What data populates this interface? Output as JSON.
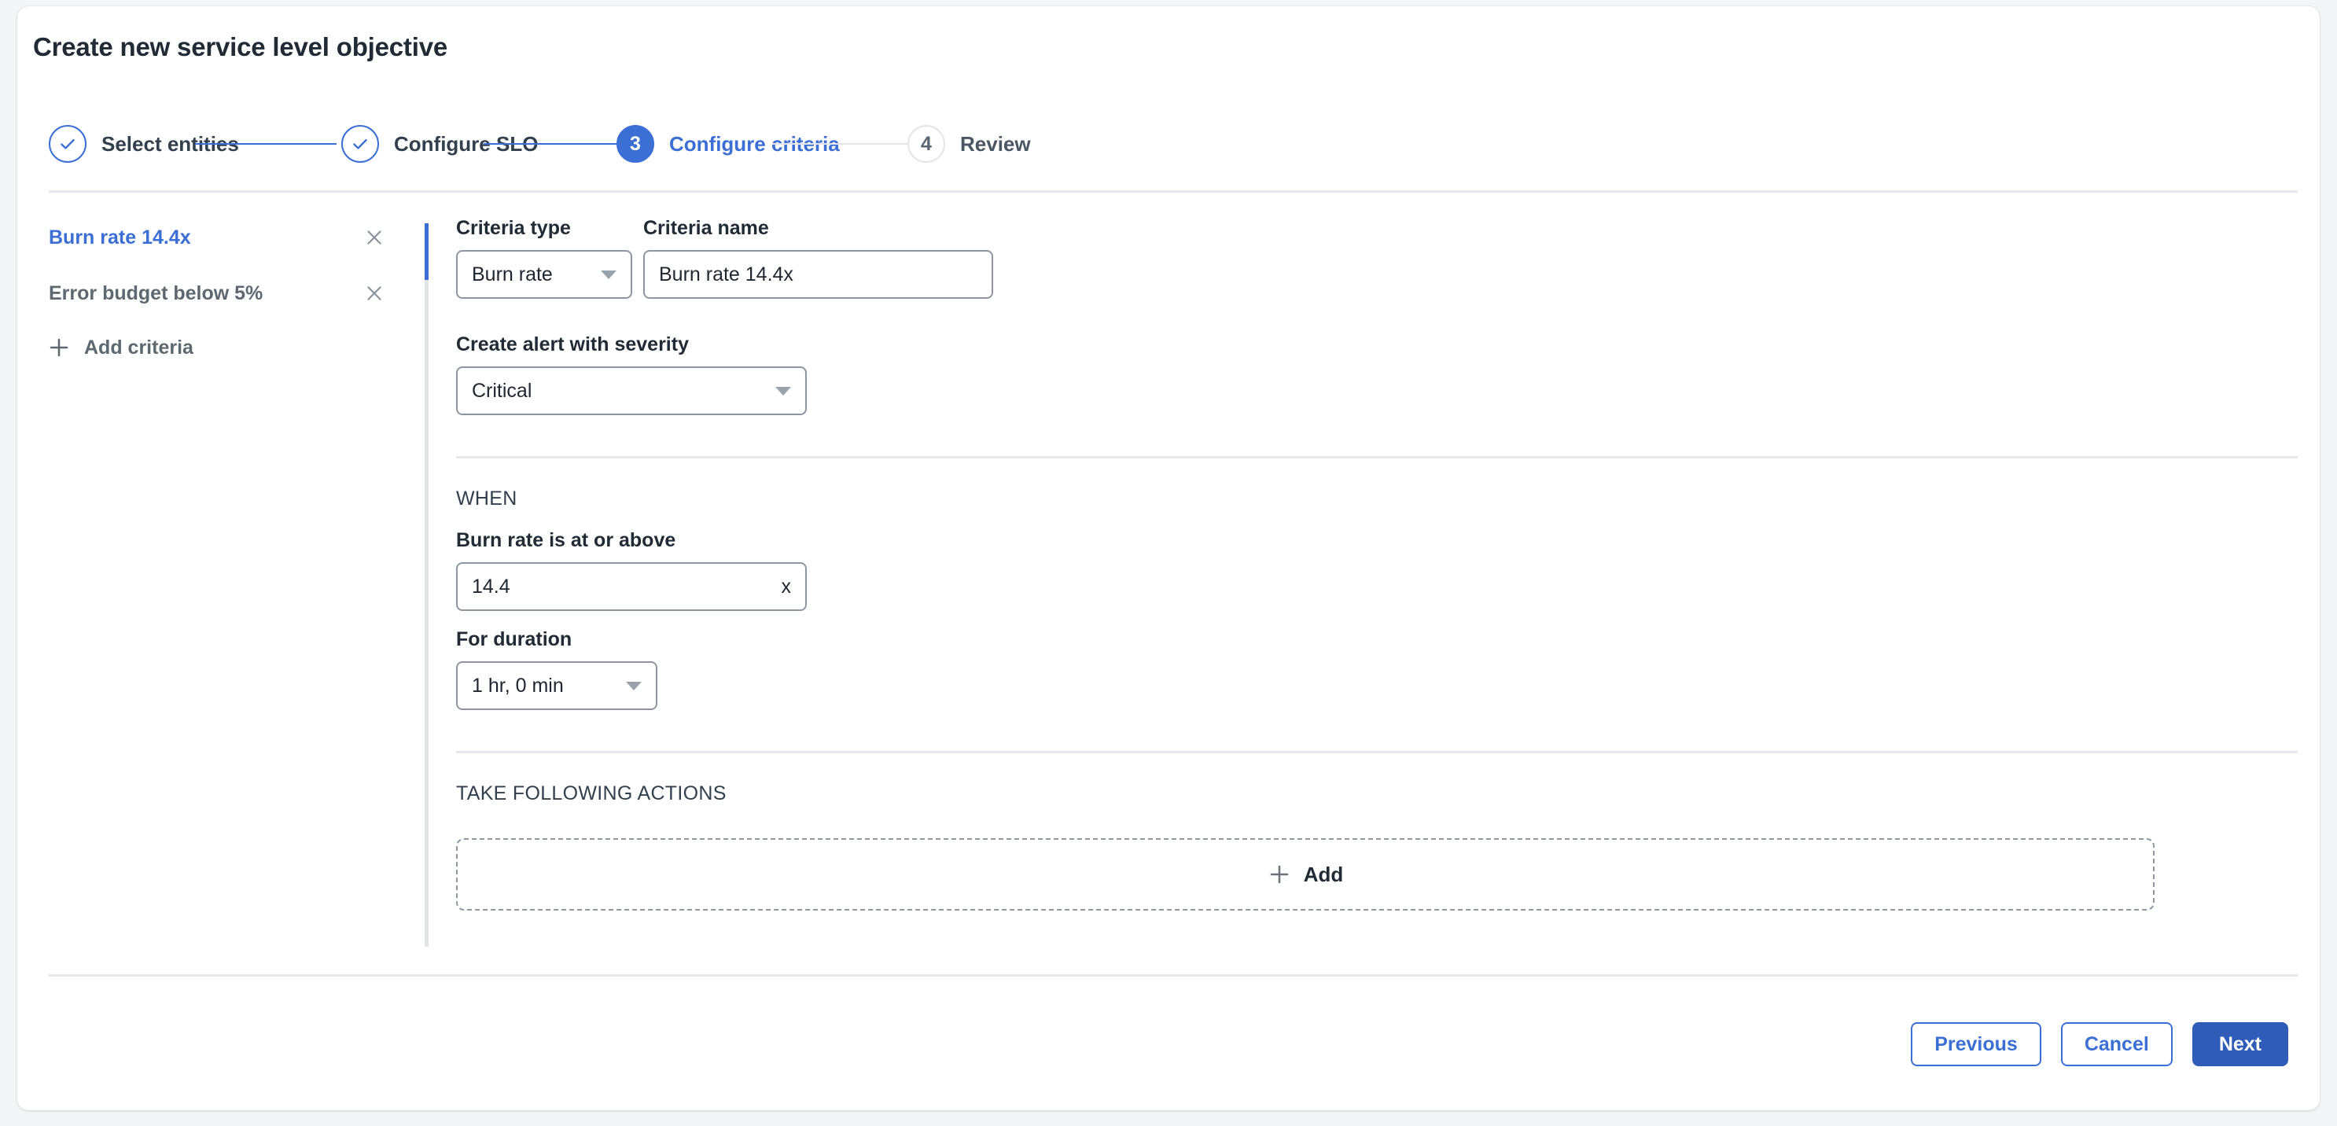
{
  "header": {
    "title": "Create new service level objective"
  },
  "stepper": {
    "steps": [
      {
        "label": "Select entities",
        "number": "1",
        "state": "done"
      },
      {
        "label": "Configure SLO",
        "number": "2",
        "state": "done"
      },
      {
        "label": "Configure criteria",
        "number": "3",
        "state": "active"
      },
      {
        "label": "Review",
        "number": "4",
        "state": "pending"
      }
    ]
  },
  "criteria_sidebar": {
    "items": [
      {
        "label": "Burn rate 14.4x",
        "selected": true
      },
      {
        "label": "Error budget below 5%",
        "selected": false
      }
    ],
    "add_label": "Add criteria"
  },
  "form": {
    "criteria_type": {
      "label": "Criteria type",
      "value": "Burn rate"
    },
    "criteria_name": {
      "label": "Criteria name",
      "value": "Burn rate 14.4x"
    },
    "severity": {
      "label": "Create alert with severity",
      "value": "Critical"
    },
    "when_heading": "WHEN",
    "burn_rate": {
      "label": "Burn rate is at or above",
      "value": "14.4",
      "suffix": "x"
    },
    "duration": {
      "label": "For duration",
      "value": "1 hr, 0 min"
    },
    "actions_heading": "TAKE FOLLOWING ACTIONS",
    "add_action_label": "Add"
  },
  "footer": {
    "previous_label": "Previous",
    "cancel_label": "Cancel",
    "next_label": "Next"
  },
  "colors": {
    "accent": "#3b6fd4",
    "primary_button": "#2e5cb8",
    "text": "#212b36",
    "muted_text": "#5d6871",
    "border": "#8e97a1",
    "divider": "#e5e7ea",
    "page_bg": "#f4f5f7"
  }
}
